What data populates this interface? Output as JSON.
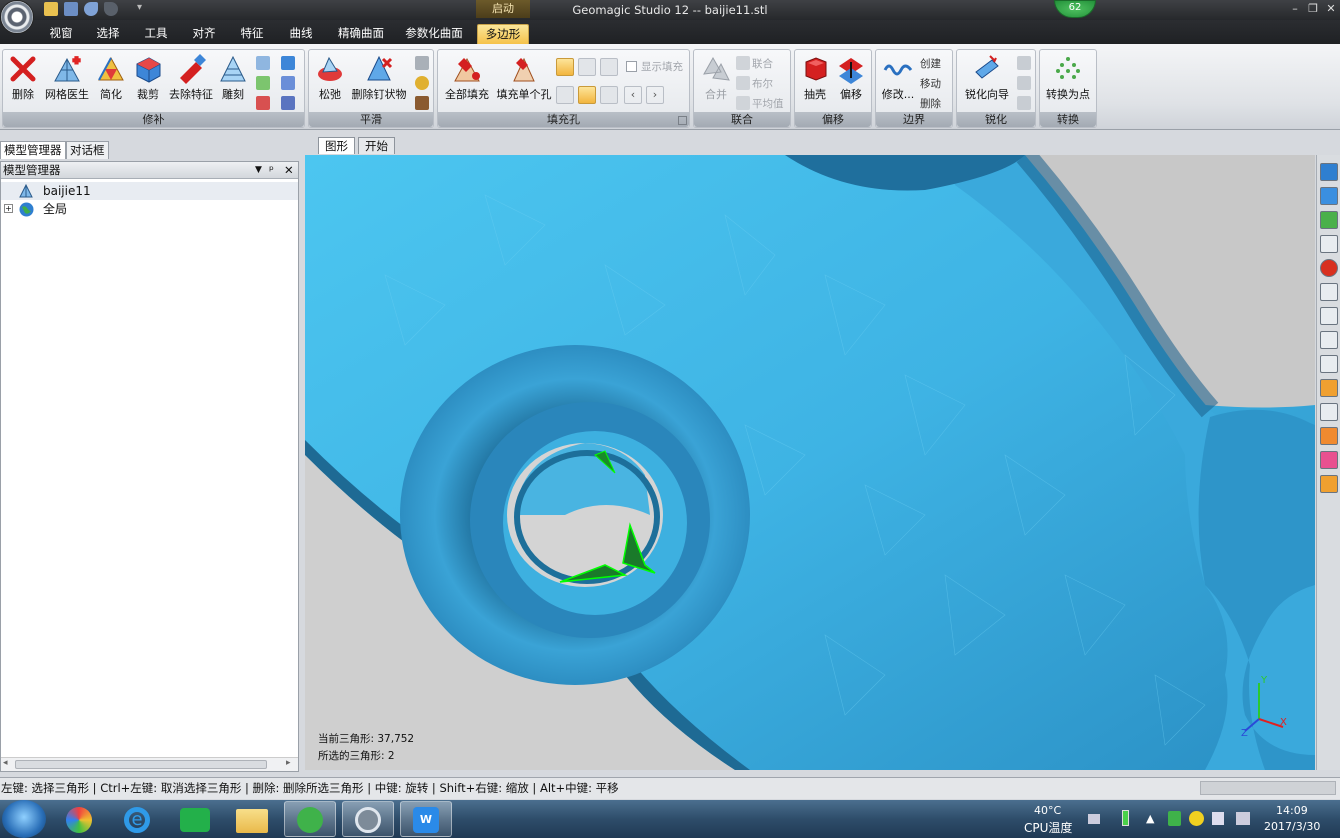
{
  "window": {
    "title": "Geomagic Studio 12 -- baijie11.stl",
    "context_tab": "启动",
    "notification_count": "62"
  },
  "quick_access": [
    "folder-icon",
    "save-icon",
    "undo-icon",
    "redo-icon"
  ],
  "ribbon_tabs": [
    {
      "label": "视窗",
      "active": false
    },
    {
      "label": "选择",
      "active": false
    },
    {
      "label": "工具",
      "active": false
    },
    {
      "label": "对齐",
      "active": false
    },
    {
      "label": "特征",
      "active": false
    },
    {
      "label": "曲线",
      "active": false
    },
    {
      "label": "精确曲面",
      "active": false
    },
    {
      "label": "参数化曲面",
      "active": false
    },
    {
      "label": "多边形",
      "active": true
    }
  ],
  "groups": {
    "repair": {
      "label": "修补",
      "buttons": [
        "删除",
        "网格医生",
        "简化",
        "裁剪",
        "去除特征",
        "雕刻"
      ]
    },
    "smooth": {
      "label": "平滑",
      "buttons": [
        "松弛",
        "删除钉状物"
      ]
    },
    "fill": {
      "label": "填充孔",
      "buttons": [
        "全部填充",
        "填充单个孔"
      ],
      "checkbox": "显示填充"
    },
    "union": {
      "label": "联合",
      "buttons": [
        "合并"
      ],
      "small": [
        "联合",
        "布尔",
        "平均值"
      ]
    },
    "offset": {
      "label": "偏移",
      "buttons": [
        "抽壳",
        "偏移"
      ]
    },
    "boundary": {
      "label": "边界",
      "buttons": [
        "修改..."
      ],
      "small": [
        "创建",
        "移动",
        "删除"
      ]
    },
    "sharpen": {
      "label": "锐化",
      "buttons": [
        "锐化向导"
      ]
    },
    "convert": {
      "label": "转换",
      "buttons": [
        "转换为点"
      ]
    }
  },
  "panel": {
    "tabs": [
      "模型管理器",
      "对话框"
    ],
    "title": "模型管理器",
    "tree": [
      {
        "label": "baijie11",
        "icon": "mesh-icon",
        "selected": true
      },
      {
        "label": "全局",
        "icon": "globe-icon",
        "selected": false
      }
    ]
  },
  "viewport": {
    "tabs": [
      "图形",
      "开始"
    ],
    "current_triangles_label": "当前三角形: 37,752",
    "selected_triangles_label": "所选的三角形: 2",
    "axes": {
      "x": "X",
      "y": "Y",
      "z": "Z"
    }
  },
  "status_text": "左键: 选择三角形 | Ctrl+左键: 取消选择三角形 | 删除: 删除所选三角形 | 中键: 旋转 | Shift+右键: 缩放 | Alt+中键: 平移",
  "taskbar": {
    "apps": [
      "start-orb",
      "app-icon",
      "ie-icon",
      "iqiyi-icon",
      "explorer-icon",
      "360-icon",
      "geomagic-icon",
      "wps-icon"
    ],
    "temp": "40°C",
    "temp_label": "CPU温度",
    "time": "14:09",
    "date": "2017/3/30"
  },
  "colors": {
    "mesh": "#3fb6e6",
    "mesh_dark": "#1d6f9a",
    "accent": "#f5c24a",
    "selection": "#00ff00"
  }
}
